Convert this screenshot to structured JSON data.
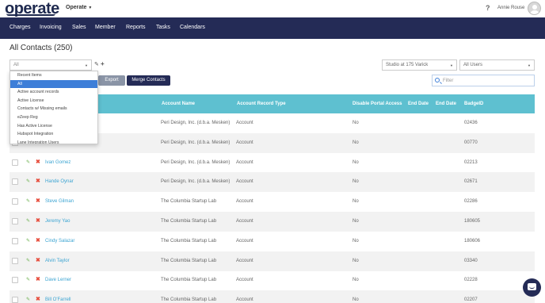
{
  "header": {
    "logo": "operate",
    "location_menu": "Operate",
    "help_icon": "question-icon",
    "user_name": "Annie Rouse"
  },
  "nav": {
    "items": [
      "Charges",
      "Invoicing",
      "Sales",
      "Member",
      "Reports",
      "Tasks",
      "Calendars"
    ]
  },
  "page": {
    "title": "All Contacts (250)"
  },
  "toolbar": {
    "view_select": "All",
    "export_label": "Export",
    "merge_label": "Merge Contacts",
    "location_select": "Studio at 175 Varick",
    "users_select": "All Users",
    "filter_placeholder": "Filter"
  },
  "view_dropdown": {
    "options": [
      "Recent Items",
      "All",
      "Active account records",
      "Active License",
      "Contacts w/ Missing emails",
      "eZeep Reg",
      "Has Active License",
      "Hubspot Integration",
      "Lane Integration Users"
    ],
    "selected": "All"
  },
  "table": {
    "headers": {
      "account_name": "Account Name",
      "record_type": "Account Record Type",
      "disable_portal": "Disable Portal Access",
      "end_date_1": "End Date",
      "end_date_2": "End Date",
      "badge_id": "BadgeID"
    },
    "rows": [
      {
        "name": "",
        "account": "Peri Design, Inc. (d.b.a. Mesken)",
        "type": "Account",
        "disable": "No",
        "badge": "02436"
      },
      {
        "name": "",
        "account": "Peri Design, Inc. (d.b.a. Mesken)",
        "type": "Account",
        "disable": "No",
        "badge": "00770"
      },
      {
        "name": "Ivan Gomez",
        "account": "Peri Design, Inc. (d.b.a. Mesken)",
        "type": "Account",
        "disable": "No",
        "badge": "02213"
      },
      {
        "name": "Hande Oynar",
        "account": "Peri Design, Inc. (d.b.a. Mesken)",
        "type": "Account",
        "disable": "No",
        "badge": "02671"
      },
      {
        "name": "Steve Gilman",
        "account": "The Columbia Startup Lab",
        "type": "Account",
        "disable": "No",
        "badge": "02286"
      },
      {
        "name": "Jeremy Yao",
        "account": "The Columbia Startup Lab",
        "type": "Account",
        "disable": "No",
        "badge": "180605"
      },
      {
        "name": "Cindy Salazar",
        "account": "The Columbia Startup Lab",
        "type": "Account",
        "disable": "No",
        "badge": "180606"
      },
      {
        "name": "Alvin Taylor",
        "account": "The Columbia Startup Lab",
        "type": "Account",
        "disable": "No",
        "badge": "03340"
      },
      {
        "name": "Dave Lerner",
        "account": "The Columbia Startup Lab",
        "type": "Account",
        "disable": "No",
        "badge": "02228"
      },
      {
        "name": "Bill O'Farrell",
        "account": "The Columbia Startup Lab",
        "type": "Account",
        "disable": "No",
        "badge": "02207"
      }
    ]
  },
  "chat": {
    "icon": "chat-icon"
  }
}
